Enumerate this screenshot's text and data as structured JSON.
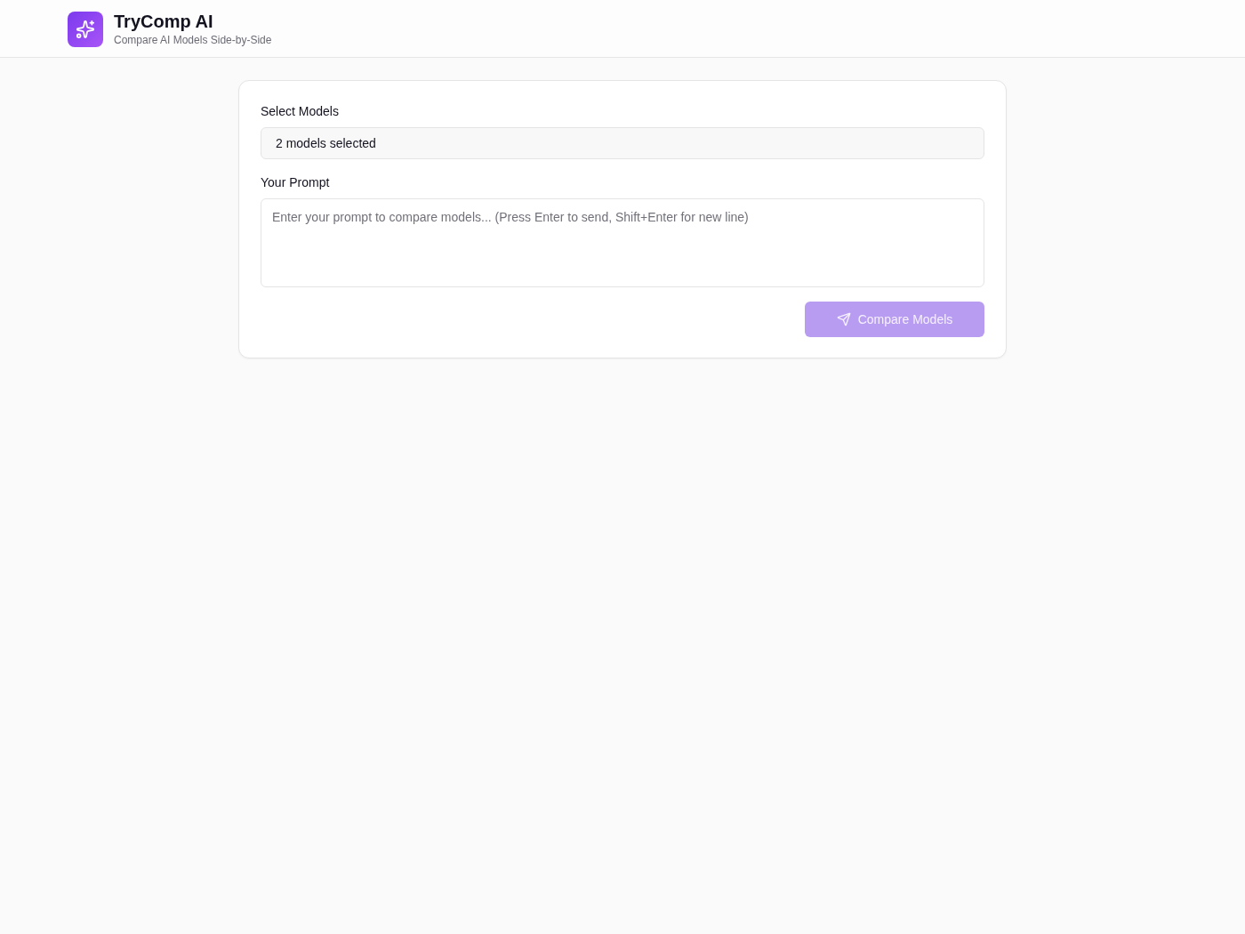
{
  "header": {
    "title": "TryComp AI",
    "subtitle": "Compare AI Models Side-by-Side"
  },
  "form": {
    "model_select": {
      "label": "Select Models",
      "value": "2 models selected"
    },
    "prompt": {
      "label": "Your Prompt",
      "placeholder": "Enter your prompt to compare models... (Press Enter to send, Shift+Enter for new line)"
    },
    "submit_button": {
      "label": "Compare Models",
      "disabled": true
    }
  }
}
